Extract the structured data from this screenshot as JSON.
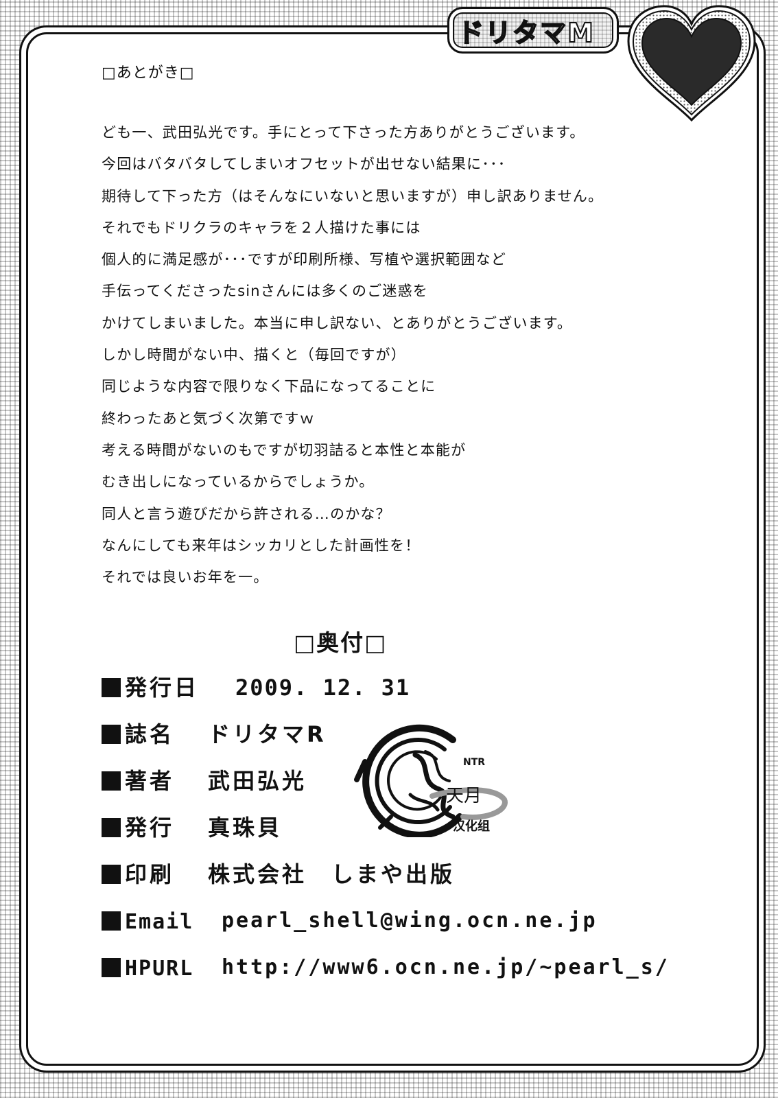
{
  "header": {
    "tab_title": "ドリタマM"
  },
  "afterword": {
    "heading": "□あとがき□",
    "lines": [
      "ども一、武田弘光です。手にとって下さった方ありがとうございます。",
      "今回はバタバタしてしまいオフセットが出せない結果に･･･",
      "期待して下った方（はそんなにいないと思いますが）申し訳ありません。",
      "それでもドリクラのキャラを２人描けた事には",
      "個人的に満足感が･･･ですが印刷所様、写植や選択範囲など",
      "手伝ってくださったsinさんには多くのご迷惑を",
      "かけてしまいました。本当に申し訳ない、とありがとうございます。",
      "しかし時間がない中、描くと（毎回ですが）",
      "同じような内容で限りなく下品になってることに",
      "終わったあと気づく次第ですｗ",
      "考える時間がないのもですが切羽詰ると本性と本能が",
      "むき出しになっているからでしょうか。",
      "同人と言う遊びだから許される…のかな？",
      "なんにしても来年はシッカリとした計画性を！",
      "それでは良いお年を一。"
    ]
  },
  "colophon": {
    "heading": "□奥付□",
    "rows": [
      {
        "label": "発行日",
        "value": "2009. 12. 31"
      },
      {
        "label": "誌名",
        "value": "ドリタマR"
      },
      {
        "label": "著者",
        "value": "武田弘光"
      },
      {
        "label": "発行",
        "value": "真珠貝"
      },
      {
        "label": "印刷",
        "value": "株式会社　しまや出版"
      },
      {
        "label": "Email",
        "value": "pearl_shell@wing.ocn.ne.jp"
      },
      {
        "label": "HPURL",
        "value": "http://www6.ocn.ne.jp/~pearl_s/"
      }
    ]
  },
  "watermark": {
    "tag": "NTR",
    "name": "天月",
    "group": "汉化组"
  }
}
